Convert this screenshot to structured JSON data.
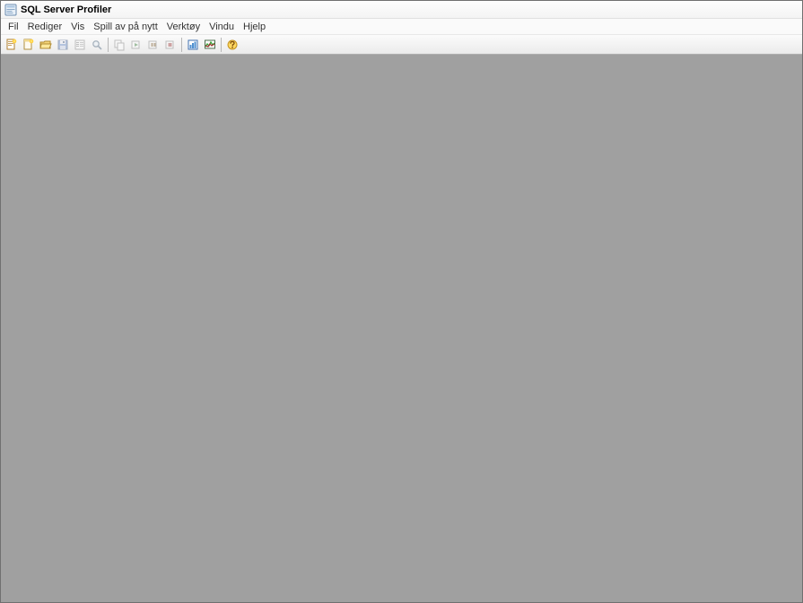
{
  "window": {
    "title": "SQL Server Profiler"
  },
  "menu": {
    "items": [
      {
        "label": "Fil"
      },
      {
        "label": "Rediger"
      },
      {
        "label": "Vis"
      },
      {
        "label": "Spill av på nytt"
      },
      {
        "label": "Verktøy"
      },
      {
        "label": "Vindu"
      },
      {
        "label": "Hjelp"
      }
    ]
  },
  "toolbar": {
    "groups": [
      {
        "icons": [
          "new-trace-icon",
          "new-template-icon",
          "open-file-icon",
          "save-icon",
          "properties-icon",
          "find-icon"
        ]
      },
      {
        "icons": [
          "copy-icon",
          "run-trace-icon",
          "pause-trace-icon",
          "stop-trace-icon"
        ]
      },
      {
        "icons": [
          "tuning-advisor-icon",
          "performance-monitor-icon"
        ]
      },
      {
        "icons": [
          "help-icon"
        ]
      }
    ]
  }
}
